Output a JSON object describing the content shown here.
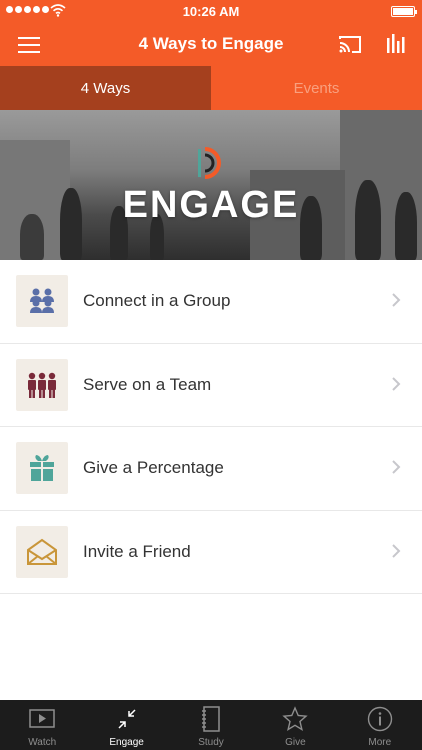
{
  "status_bar": {
    "time": "10:26 AM"
  },
  "header": {
    "title": "4 Ways to Engage",
    "accent_color": "#f45b28"
  },
  "tabs": [
    {
      "label": "4 Ways",
      "active": true
    },
    {
      "label": "Events",
      "active": false
    }
  ],
  "hero": {
    "title": "ENGAGE"
  },
  "list": [
    {
      "label": "Connect in a Group",
      "icon": "group-people-icon",
      "color": "#5a6fa8"
    },
    {
      "label": "Serve on a Team",
      "icon": "team-people-icon",
      "color": "#7a2a3a"
    },
    {
      "label": "Give a Percentage",
      "icon": "gift-icon",
      "color": "#4fa59a"
    },
    {
      "label": "Invite a Friend",
      "icon": "envelope-icon",
      "color": "#c9963a"
    }
  ],
  "tabbar": [
    {
      "label": "Watch",
      "icon": "video-icon",
      "active": false
    },
    {
      "label": "Engage",
      "icon": "arrows-in-icon",
      "active": true
    },
    {
      "label": "Study",
      "icon": "notebook-icon",
      "active": false
    },
    {
      "label": "Give",
      "icon": "star-icon",
      "active": false
    },
    {
      "label": "More",
      "icon": "info-icon",
      "active": false
    }
  ]
}
